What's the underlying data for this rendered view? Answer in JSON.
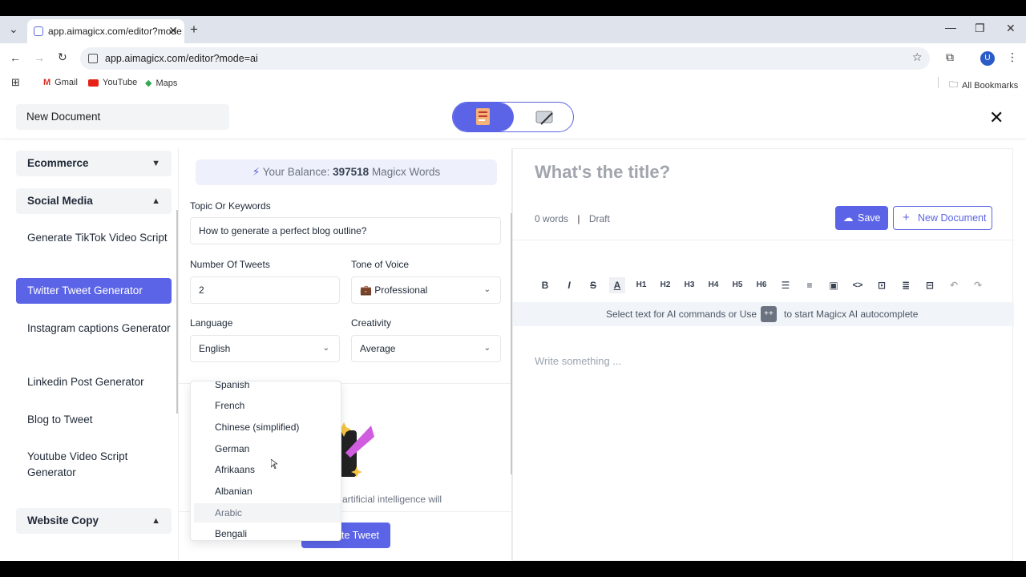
{
  "browser": {
    "tab_title": "app.aimagicx.com/editor?mode",
    "url": "app.aimagicx.com/editor?mode=ai",
    "bookmarks": [
      "Gmail",
      "YouTube",
      "Maps"
    ],
    "all_bookmarks": "All Bookmarks",
    "profile_initial": "U"
  },
  "header": {
    "doc_name": "New Document"
  },
  "sidebar": {
    "sections": [
      {
        "label": "Ecommerce",
        "chevron": "▼"
      },
      {
        "label": "Social Media",
        "chevron": "▲"
      },
      {
        "label": "Website Copy",
        "chevron": "▲"
      }
    ],
    "items": [
      {
        "label": "Generate TikTok Video Script"
      },
      {
        "label": "Twitter Tweet Generator",
        "active": true
      },
      {
        "label": "Instagram captions Generator"
      },
      {
        "label": "Linkedin Post Generator"
      },
      {
        "label": "Blog to Tweet"
      },
      {
        "label": "Youtube Video Script Generator"
      }
    ]
  },
  "form": {
    "balance_prefix": "Your Balance:",
    "balance_value": "397518",
    "balance_suffix": "Magicx Words",
    "topic_label": "Topic Or Keywords",
    "topic_value": "How to generate a perfect blog outline?",
    "tweets_label": "Number Of Tweets",
    "tweets_value": "2",
    "tone_label": "Tone of Voice",
    "tone_value": "💼 Professional",
    "language_label": "Language",
    "language_value": "English",
    "creativity_label": "Creativity",
    "creativity_value": "Average",
    "language_options": [
      "Spanish",
      "French",
      "Chinese (simplified)",
      "German",
      "Afrikaans",
      "Albanian",
      "Arabic",
      "Bengali"
    ],
    "hovered_option": "Arabic",
    "illustration_text": "artificial intelligence will",
    "generate_button": "te Tweet"
  },
  "editor": {
    "title_placeholder": "What's the title?",
    "word_count": "0 words",
    "status": "Draft",
    "save_label": "Save",
    "new_doc_label": "New Document",
    "toolbar": [
      "B",
      "I",
      "S",
      "A",
      "H1",
      "H2",
      "H3",
      "H4",
      "H5",
      "H6"
    ],
    "hint_before": "Select text for AI commands or Use",
    "hint_key": "++",
    "hint_after": "to start Magicx AI autocomplete",
    "body_placeholder": "Write something ..."
  },
  "colors": {
    "accent": "#5b64e6",
    "balance_bg": "#eef0fb"
  }
}
